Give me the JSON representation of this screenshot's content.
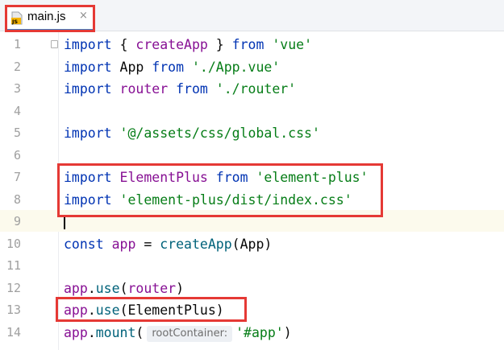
{
  "tab": {
    "label": "main.js",
    "close": "×",
    "icon": "js-file-icon"
  },
  "colors": {
    "keyword": "#0033b3",
    "string": "#067d17",
    "function": "#00627a",
    "variable": "#871094",
    "highlight_box": "#e53935"
  },
  "lines": [
    {
      "n": "1",
      "tokens": [
        [
          "kw",
          "import"
        ],
        [
          "plain",
          " { "
        ],
        [
          "var",
          "createApp"
        ],
        [
          "plain",
          " } "
        ],
        [
          "kw",
          "from"
        ],
        [
          "plain",
          " "
        ],
        [
          "str",
          "'vue'"
        ]
      ]
    },
    {
      "n": "2",
      "tokens": [
        [
          "kw",
          "import"
        ],
        [
          "plain",
          " App "
        ],
        [
          "kw",
          "from"
        ],
        [
          "plain",
          " "
        ],
        [
          "str",
          "'./App.vue'"
        ]
      ]
    },
    {
      "n": "3",
      "tokens": [
        [
          "kw",
          "import"
        ],
        [
          "plain",
          " "
        ],
        [
          "var",
          "router"
        ],
        [
          "plain",
          " "
        ],
        [
          "kw",
          "from"
        ],
        [
          "plain",
          " "
        ],
        [
          "str",
          "'./router'"
        ]
      ]
    },
    {
      "n": "4",
      "tokens": []
    },
    {
      "n": "5",
      "tokens": [
        [
          "kw",
          "import"
        ],
        [
          "plain",
          " "
        ],
        [
          "str",
          "'@/assets/css/global.css'"
        ]
      ]
    },
    {
      "n": "6",
      "tokens": []
    },
    {
      "n": "7",
      "tokens": [
        [
          "kw",
          "import"
        ],
        [
          "plain",
          " "
        ],
        [
          "var",
          "ElementPlus"
        ],
        [
          "plain",
          " "
        ],
        [
          "kw",
          "from"
        ],
        [
          "plain",
          " "
        ],
        [
          "str",
          "'element-plus'"
        ]
      ]
    },
    {
      "n": "8",
      "tokens": [
        [
          "kw",
          "import"
        ],
        [
          "plain",
          " "
        ],
        [
          "str",
          "'element-plus/dist/index.css'"
        ]
      ]
    },
    {
      "n": "9",
      "tokens": []
    },
    {
      "n": "10",
      "tokens": [
        [
          "kw",
          "const"
        ],
        [
          "plain",
          " "
        ],
        [
          "var",
          "app"
        ],
        [
          "plain",
          " = "
        ],
        [
          "fn",
          "createApp"
        ],
        [
          "plain",
          "(App)"
        ]
      ]
    },
    {
      "n": "11",
      "tokens": []
    },
    {
      "n": "12",
      "tokens": [
        [
          "var",
          "app"
        ],
        [
          "plain",
          "."
        ],
        [
          "fn",
          "use"
        ],
        [
          "plain",
          "("
        ],
        [
          "var",
          "router"
        ],
        [
          "plain",
          ")"
        ]
      ]
    },
    {
      "n": "13",
      "tokens": [
        [
          "var",
          "app"
        ],
        [
          "plain",
          "."
        ],
        [
          "fn",
          "use"
        ],
        [
          "plain",
          "(ElementPlus)"
        ]
      ]
    },
    {
      "n": "14",
      "tokens": [
        [
          "var",
          "app"
        ],
        [
          "plain",
          "."
        ],
        [
          "fn",
          "mount"
        ],
        [
          "plain",
          "("
        ],
        [
          "hint",
          "rootContainer:"
        ],
        [
          "str",
          "'#app'"
        ],
        [
          "plain",
          ")"
        ]
      ]
    }
  ]
}
